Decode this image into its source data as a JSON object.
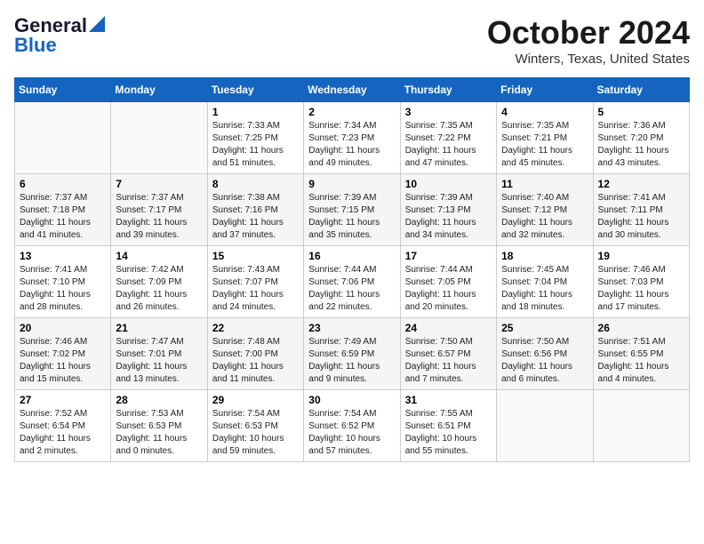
{
  "header": {
    "logo_line1": "General",
    "logo_line2": "Blue",
    "month": "October 2024",
    "location": "Winters, Texas, United States"
  },
  "days_of_week": [
    "Sunday",
    "Monday",
    "Tuesday",
    "Wednesday",
    "Thursday",
    "Friday",
    "Saturday"
  ],
  "weeks": [
    [
      {
        "day": "",
        "empty": true
      },
      {
        "day": "",
        "empty": true
      },
      {
        "day": "1",
        "sunrise": "Sunrise: 7:33 AM",
        "sunset": "Sunset: 7:25 PM",
        "daylight": "Daylight: 11 hours and 51 minutes."
      },
      {
        "day": "2",
        "sunrise": "Sunrise: 7:34 AM",
        "sunset": "Sunset: 7:23 PM",
        "daylight": "Daylight: 11 hours and 49 minutes."
      },
      {
        "day": "3",
        "sunrise": "Sunrise: 7:35 AM",
        "sunset": "Sunset: 7:22 PM",
        "daylight": "Daylight: 11 hours and 47 minutes."
      },
      {
        "day": "4",
        "sunrise": "Sunrise: 7:35 AM",
        "sunset": "Sunset: 7:21 PM",
        "daylight": "Daylight: 11 hours and 45 minutes."
      },
      {
        "day": "5",
        "sunrise": "Sunrise: 7:36 AM",
        "sunset": "Sunset: 7:20 PM",
        "daylight": "Daylight: 11 hours and 43 minutes."
      }
    ],
    [
      {
        "day": "6",
        "sunrise": "Sunrise: 7:37 AM",
        "sunset": "Sunset: 7:18 PM",
        "daylight": "Daylight: 11 hours and 41 minutes."
      },
      {
        "day": "7",
        "sunrise": "Sunrise: 7:37 AM",
        "sunset": "Sunset: 7:17 PM",
        "daylight": "Daylight: 11 hours and 39 minutes."
      },
      {
        "day": "8",
        "sunrise": "Sunrise: 7:38 AM",
        "sunset": "Sunset: 7:16 PM",
        "daylight": "Daylight: 11 hours and 37 minutes."
      },
      {
        "day": "9",
        "sunrise": "Sunrise: 7:39 AM",
        "sunset": "Sunset: 7:15 PM",
        "daylight": "Daylight: 11 hours and 35 minutes."
      },
      {
        "day": "10",
        "sunrise": "Sunrise: 7:39 AM",
        "sunset": "Sunset: 7:13 PM",
        "daylight": "Daylight: 11 hours and 34 minutes."
      },
      {
        "day": "11",
        "sunrise": "Sunrise: 7:40 AM",
        "sunset": "Sunset: 7:12 PM",
        "daylight": "Daylight: 11 hours and 32 minutes."
      },
      {
        "day": "12",
        "sunrise": "Sunrise: 7:41 AM",
        "sunset": "Sunset: 7:11 PM",
        "daylight": "Daylight: 11 hours and 30 minutes."
      }
    ],
    [
      {
        "day": "13",
        "sunrise": "Sunrise: 7:41 AM",
        "sunset": "Sunset: 7:10 PM",
        "daylight": "Daylight: 11 hours and 28 minutes."
      },
      {
        "day": "14",
        "sunrise": "Sunrise: 7:42 AM",
        "sunset": "Sunset: 7:09 PM",
        "daylight": "Daylight: 11 hours and 26 minutes."
      },
      {
        "day": "15",
        "sunrise": "Sunrise: 7:43 AM",
        "sunset": "Sunset: 7:07 PM",
        "daylight": "Daylight: 11 hours and 24 minutes."
      },
      {
        "day": "16",
        "sunrise": "Sunrise: 7:44 AM",
        "sunset": "Sunset: 7:06 PM",
        "daylight": "Daylight: 11 hours and 22 minutes."
      },
      {
        "day": "17",
        "sunrise": "Sunrise: 7:44 AM",
        "sunset": "Sunset: 7:05 PM",
        "daylight": "Daylight: 11 hours and 20 minutes."
      },
      {
        "day": "18",
        "sunrise": "Sunrise: 7:45 AM",
        "sunset": "Sunset: 7:04 PM",
        "daylight": "Daylight: 11 hours and 18 minutes."
      },
      {
        "day": "19",
        "sunrise": "Sunrise: 7:46 AM",
        "sunset": "Sunset: 7:03 PM",
        "daylight": "Daylight: 11 hours and 17 minutes."
      }
    ],
    [
      {
        "day": "20",
        "sunrise": "Sunrise: 7:46 AM",
        "sunset": "Sunset: 7:02 PM",
        "daylight": "Daylight: 11 hours and 15 minutes."
      },
      {
        "day": "21",
        "sunrise": "Sunrise: 7:47 AM",
        "sunset": "Sunset: 7:01 PM",
        "daylight": "Daylight: 11 hours and 13 minutes."
      },
      {
        "day": "22",
        "sunrise": "Sunrise: 7:48 AM",
        "sunset": "Sunset: 7:00 PM",
        "daylight": "Daylight: 11 hours and 11 minutes."
      },
      {
        "day": "23",
        "sunrise": "Sunrise: 7:49 AM",
        "sunset": "Sunset: 6:59 PM",
        "daylight": "Daylight: 11 hours and 9 minutes."
      },
      {
        "day": "24",
        "sunrise": "Sunrise: 7:50 AM",
        "sunset": "Sunset: 6:57 PM",
        "daylight": "Daylight: 11 hours and 7 minutes."
      },
      {
        "day": "25",
        "sunrise": "Sunrise: 7:50 AM",
        "sunset": "Sunset: 6:56 PM",
        "daylight": "Daylight: 11 hours and 6 minutes."
      },
      {
        "day": "26",
        "sunrise": "Sunrise: 7:51 AM",
        "sunset": "Sunset: 6:55 PM",
        "daylight": "Daylight: 11 hours and 4 minutes."
      }
    ],
    [
      {
        "day": "27",
        "sunrise": "Sunrise: 7:52 AM",
        "sunset": "Sunset: 6:54 PM",
        "daylight": "Daylight: 11 hours and 2 minutes."
      },
      {
        "day": "28",
        "sunrise": "Sunrise: 7:53 AM",
        "sunset": "Sunset: 6:53 PM",
        "daylight": "Daylight: 11 hours and 0 minutes."
      },
      {
        "day": "29",
        "sunrise": "Sunrise: 7:54 AM",
        "sunset": "Sunset: 6:53 PM",
        "daylight": "Daylight: 10 hours and 59 minutes."
      },
      {
        "day": "30",
        "sunrise": "Sunrise: 7:54 AM",
        "sunset": "Sunset: 6:52 PM",
        "daylight": "Daylight: 10 hours and 57 minutes."
      },
      {
        "day": "31",
        "sunrise": "Sunrise: 7:55 AM",
        "sunset": "Sunset: 6:51 PM",
        "daylight": "Daylight: 10 hours and 55 minutes."
      },
      {
        "day": "",
        "empty": true
      },
      {
        "day": "",
        "empty": true
      }
    ]
  ]
}
